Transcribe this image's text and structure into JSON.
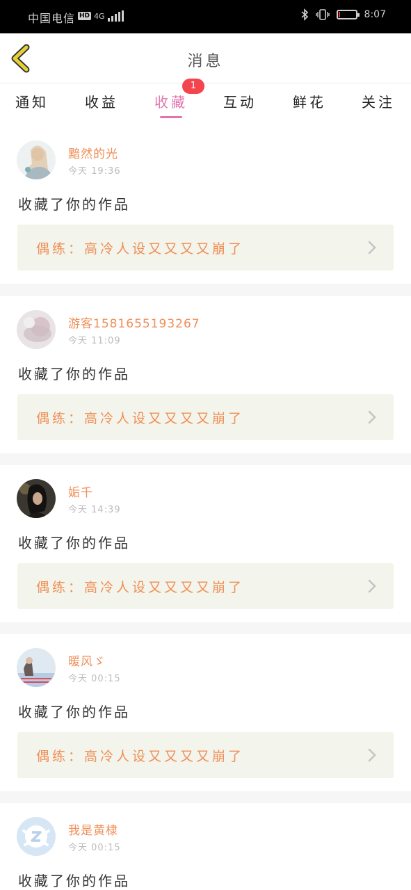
{
  "status_bar": {
    "carrier": "中国电信",
    "hd": "HD",
    "network": "4G",
    "time": "8:07",
    "battery_level": 0.1,
    "battery_color": "#e53935"
  },
  "nav": {
    "title": "消息",
    "back_icon": "chevron-left-icon",
    "back_color": "#e6d038"
  },
  "tabs": {
    "items": [
      "通知",
      "收益",
      "收藏",
      "互动",
      "鲜花",
      "关注"
    ],
    "active_index": 2,
    "active_color": "#e274ad",
    "badge": "1"
  },
  "feed": {
    "items": [
      {
        "user": "黯然的光",
        "time": "今天 19:36",
        "action": "收藏了你的作品",
        "work": "偶练：高冷人设又又又又崩了",
        "avatar": "avatar-girl-photo"
      },
      {
        "user": "游客1581655193267",
        "time": "今天 11:09",
        "action": "收藏了你的作品",
        "work": "偶练：高冷人设又又又又崩了",
        "avatar": "avatar-blurred-photo"
      },
      {
        "user": "姤千",
        "time": "今天 14:39",
        "action": "收藏了你的作品",
        "work": "偶练：高冷人设又又又又崩了",
        "avatar": "avatar-dark-portrait"
      },
      {
        "user": "暖风ゞ",
        "time": "今天 00:15",
        "action": "收藏了你的作品",
        "work": "偶练：高冷人设又又又又崩了",
        "avatar": "avatar-sky-photo"
      },
      {
        "user": "我是黄棣",
        "time": "今天 00:15",
        "action": "收藏了你的作品",
        "work": "",
        "avatar": "qq-default-avatar"
      }
    ]
  }
}
